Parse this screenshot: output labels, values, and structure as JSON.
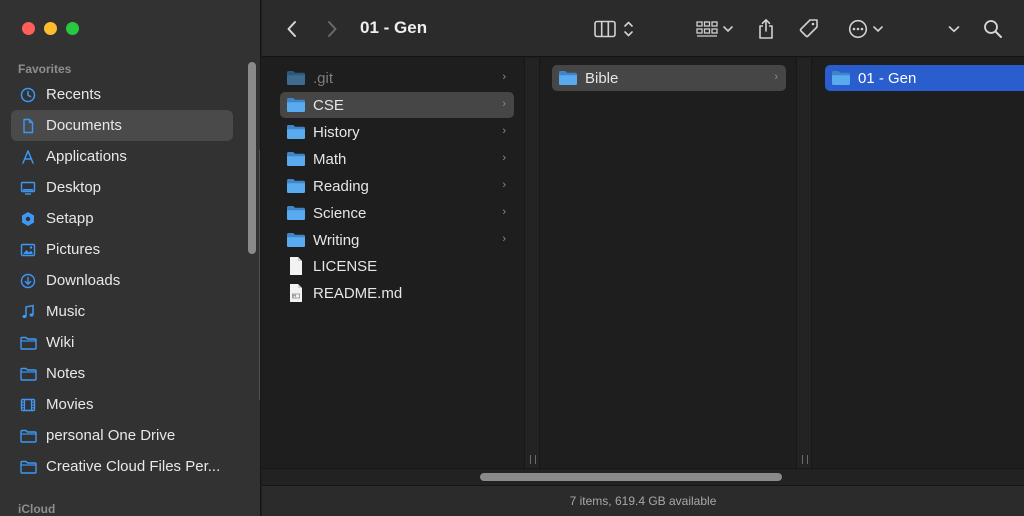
{
  "sidebar": {
    "favorites_label": "Favorites",
    "icloud_label": "iCloud",
    "items": [
      {
        "label": "Recents",
        "icon": "clock-icon"
      },
      {
        "label": "Documents",
        "icon": "document-icon"
      },
      {
        "label": "Applications",
        "icon": "applications-icon"
      },
      {
        "label": "Desktop",
        "icon": "desktop-icon"
      },
      {
        "label": "Setapp",
        "icon": "setapp-icon"
      },
      {
        "label": "Pictures",
        "icon": "pictures-icon"
      },
      {
        "label": "Downloads",
        "icon": "download-icon"
      },
      {
        "label": "Music",
        "icon": "music-icon"
      },
      {
        "label": "Wiki",
        "icon": "folder-icon"
      },
      {
        "label": "Notes",
        "icon": "folder-icon"
      },
      {
        "label": "Movies",
        "icon": "movies-icon"
      },
      {
        "label": "personal One Drive",
        "icon": "folder-icon"
      },
      {
        "label": "Creative Cloud Files Per...",
        "icon": "folder-icon"
      }
    ],
    "selected": "Documents"
  },
  "toolbar": {
    "title": "01 - Gen"
  },
  "columns": {
    "col1": [
      {
        "label": ".git",
        "type": "folder"
      },
      {
        "label": "CSE",
        "type": "folder"
      },
      {
        "label": "History",
        "type": "folder"
      },
      {
        "label": "Math",
        "type": "folder"
      },
      {
        "label": "Reading",
        "type": "folder"
      },
      {
        "label": "Science",
        "type": "folder"
      },
      {
        "label": "Writing",
        "type": "folder"
      },
      {
        "label": "LICENSE",
        "type": "file"
      },
      {
        "label": "README.md",
        "type": "file"
      }
    ],
    "col2": [
      {
        "label": "Bible",
        "type": "folder"
      }
    ],
    "col3": [
      {
        "label": "01 - Gen",
        "type": "folder"
      }
    ]
  },
  "status": {
    "text": "7 items, 619.4 GB available"
  },
  "colors": {
    "accent": "#2a5dce",
    "sidebar_icon": "#3d97f5",
    "folder": "#5aaaf0"
  }
}
